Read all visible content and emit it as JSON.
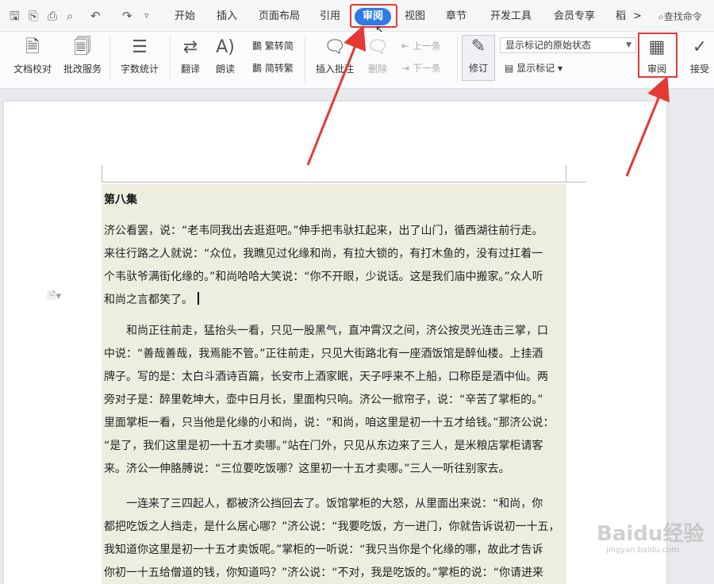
{
  "tabs": {
    "start": "开始",
    "insert": "插入",
    "layout": "页面布局",
    "reference": "引用",
    "review": "审阅",
    "view": "视图",
    "section": "章节",
    "devtools": "开发工具",
    "member": "会员专享",
    "more": "稻",
    "more_arrow": ">",
    "search": "查找命令"
  },
  "ribbon": {
    "doc_proof": "文档校对",
    "correct_service": "批改服务",
    "word_count": "字数统计",
    "translate": "翻译",
    "read_aloud": "朗读",
    "trad_to_simp": "繁转简",
    "simp_to_trad": "简转繁",
    "insert_comment": "插入批注",
    "delete": "删除",
    "prev": "上一条",
    "next": "下一条",
    "revise": "修订",
    "display_state": "显示标记的原始状态",
    "show_marks": "显示标记",
    "review_btn": "审阅",
    "accept": "接受"
  },
  "document": {
    "title": "第八集",
    "para1": [
      "济公看罢，说：“老韦同我出去逛逛吧。”伸手把韦驮扛起来，出了山门，循西湖往前行走。",
      "来往行路之人就说：“众位，我瞧见过化缘和尚，有拉大锁的，有打木鱼的，没有过扛着一",
      "个韦驮爷满街化缘的。”和尚哈哈大笑说：“你不开眼，少说话。这是我们庙中搬家。”众人听",
      "和尚之言都笑了。"
    ],
    "para2": [
      "　　和尚正往前走，猛抬头一看，只见一股黑气，直冲霄汉之间，济公按灵光连击三掌，口",
      "中说：“善哉善哉，我焉能不管。”正往前走，只见大街路北有一座酒饭馆是醉仙楼。上挂酒",
      "牌子。写的是：太白斗酒诗百篇，长安市上酒家眠，天子呼来不上船，口称臣是酒中仙。两",
      "旁对子是：醉里乾坤大，壶中日月长，里面构只响。济公一掀帘子，说：“辛苦了掌柜的。”",
      "里面掌柜一看，只当他是化缘的小和尚，说：“和尚，咱这里是初一十五才给钱。”那济公说：",
      "“是了，我们这里是初一十五才卖哪。”站在门外，只见从东边来了三人，是米粮店掌柜请客",
      "来。济公一伸胳膊说：“三位要吃饭哪？这里初一十五才卖哪。”三人一听往别家去。"
    ],
    "para3": [
      "　　一连来了三四起人，都被济公挡回去了。饭馆掌柜的大怒，从里面出来说：“和尚，你",
      "都把吃饭之人挡走，是什么居心哪？”济公说：“我要吃饭，方一进门，你就告诉说初一十五，",
      "我知道你这里是初一十五才卖饭呢。”掌柜的一听说：“我只当你是个化缘的哪，故此才告诉",
      "你初一十五给僧道的钱，你知道吗？”济公说：“不对，我是吃饭的。”掌柜的说：“你请进来"
    ]
  },
  "watermark": "Baidu经验",
  "watermark_sub": "jingyan.baidu.com",
  "colors": {
    "active_tab": "#2f7be6",
    "highlight": "#e53935",
    "text_block": "#eeeee0"
  }
}
